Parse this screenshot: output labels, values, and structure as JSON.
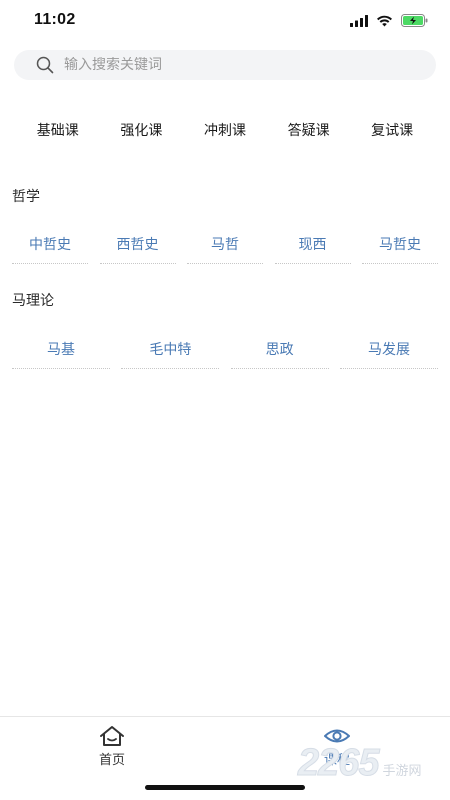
{
  "status_bar": {
    "time": "11:02"
  },
  "search": {
    "placeholder": "输入搜索关键词"
  },
  "categories": [
    "基础课",
    "强化课",
    "冲刺课",
    "答疑课",
    "复试课"
  ],
  "sections": [
    {
      "title": "哲学",
      "items": [
        "中哲史",
        "西哲史",
        "马哲",
        "现西",
        "马哲史"
      ]
    },
    {
      "title": "马理论",
      "items": [
        "马基",
        "毛中特",
        "思政",
        "马发展"
      ]
    }
  ],
  "tab_bar": {
    "tabs": [
      {
        "label": "首页",
        "icon": "home-icon",
        "active": false
      },
      {
        "label": "课程",
        "icon": "eye-icon",
        "active": true
      }
    ],
    "accent_color": "#4a7ab4"
  },
  "watermark": {
    "logo": "2265",
    "text": "手游网"
  }
}
